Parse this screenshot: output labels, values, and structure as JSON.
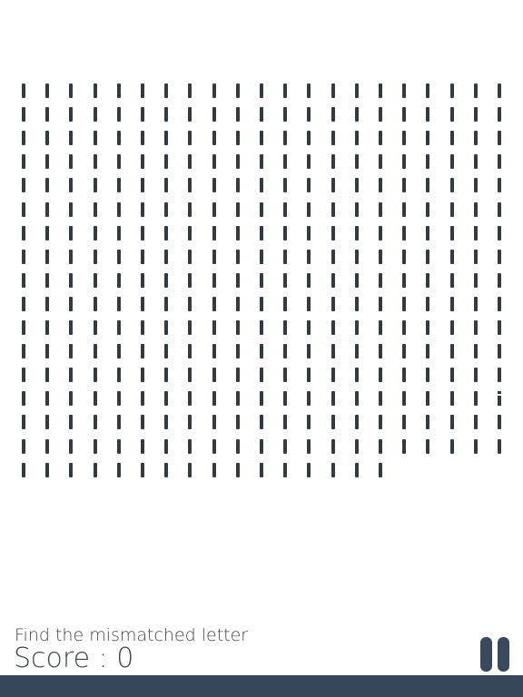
{
  "game": {
    "instruction": "Find the mismatched letter",
    "score_label": "Score : 0",
    "grid": {
      "common_letter": "l",
      "odd_letter": "i",
      "columns": 21,
      "row_lengths": [
        21,
        21,
        21,
        21,
        21,
        21,
        21,
        21,
        21,
        21,
        21,
        21,
        21,
        21,
        21,
        21,
        16
      ],
      "odd_position": {
        "row": 13,
        "col": 20
      }
    }
  },
  "colors": {
    "letter": "#333a40",
    "text": "#40474f",
    "pause_button": "#3a4a5e",
    "bottom_bar": "#36475a"
  },
  "icons": {
    "pause": "pause-icon"
  }
}
